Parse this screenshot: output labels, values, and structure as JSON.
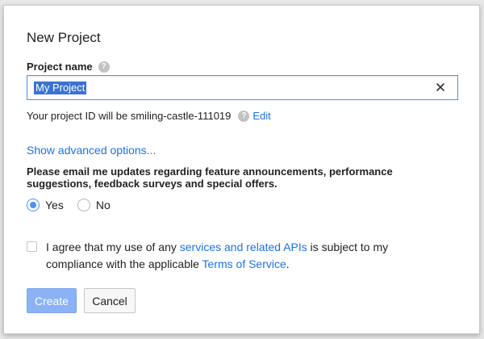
{
  "dialog": {
    "title": "New Project",
    "project_name_label": "Project name",
    "project_name_value": "My Project",
    "project_id_text": "Your project ID will be smiling-castle-111019",
    "edit_link": "Edit",
    "advanced_link": "Show advanced options...",
    "email_question": "Please email me updates regarding feature announcements, performance suggestions, feedback surveys and special offers.",
    "radio_options": [
      {
        "label": "Yes",
        "checked": true
      },
      {
        "label": "No",
        "checked": false
      }
    ],
    "agree": {
      "checked": false,
      "prefix": "I agree that my use of any ",
      "link1": "services and related APIs",
      "middle": " is subject to my compliance with the applicable ",
      "link2": "Terms of Service",
      "suffix": "."
    },
    "buttons": {
      "create": "Create",
      "cancel": "Cancel"
    }
  },
  "icons": {
    "help": "question-circle-icon",
    "clear": "close-icon"
  },
  "colors": {
    "accent": "#4d90fe",
    "link": "#1a73e8",
    "create_button": "#8ab2f5",
    "selection": "#3b73d4"
  }
}
